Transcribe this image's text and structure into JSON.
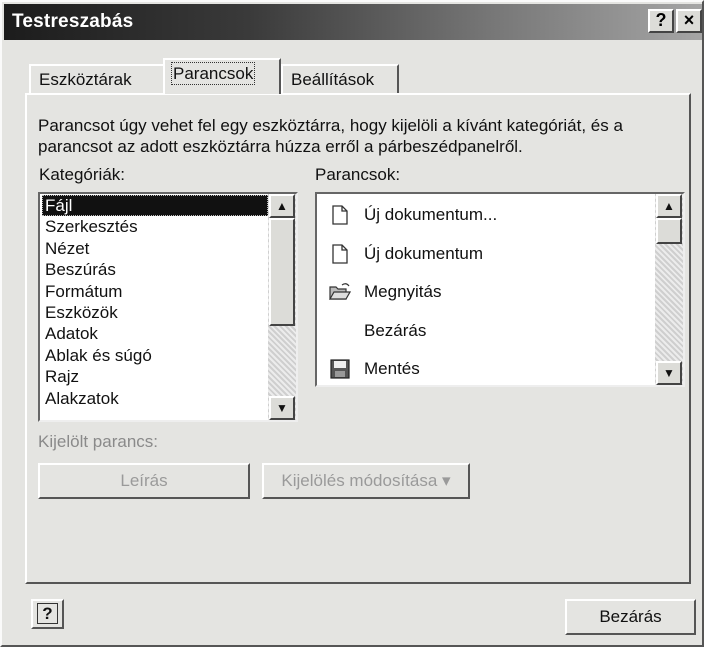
{
  "window": {
    "title": "Testreszabás",
    "help_glyph": "?",
    "close_glyph": "×"
  },
  "tabs": [
    {
      "label": "Eszköztárak"
    },
    {
      "label": "Parancsok"
    },
    {
      "label": "Beállítások"
    }
  ],
  "description": "Parancsot úgy vehet fel egy eszköztárra, hogy kijelöli a kívánt kategóriát, és a parancsot az adott eszköztárra húzza erről a párbeszédpanelről.",
  "categories": {
    "label": "Kategóriák:",
    "selected": "Fájl",
    "items": [
      "Fájl",
      "Szerkesztés",
      "Nézet",
      "Beszúrás",
      "Formátum",
      "Eszközök",
      "Adatok",
      "Ablak és súgó",
      "Rajz",
      "Alakzatok"
    ]
  },
  "commands": {
    "label": "Parancsok:",
    "items": [
      {
        "label": "Új dokumentum...",
        "icon": "new-document-icon"
      },
      {
        "label": "Új dokumentum",
        "icon": "new-document-icon"
      },
      {
        "label": "Megnyitás",
        "icon": "open-folder-icon"
      },
      {
        "label": "Bezárás",
        "icon": ""
      },
      {
        "label": "Mentés",
        "icon": "save-disk-icon"
      }
    ]
  },
  "selected_command": {
    "label": "Kijelölt parancs:",
    "description_button": "Leírás",
    "modify_button": "Kijelölés módosítása",
    "modify_arrow": "▾"
  },
  "footer": {
    "help_button": "?",
    "close_button": "Bezárás"
  },
  "colors": {
    "title_bar": "#1c1c1c",
    "selection": "#111111",
    "dialog_face": "#e4e4e1"
  }
}
